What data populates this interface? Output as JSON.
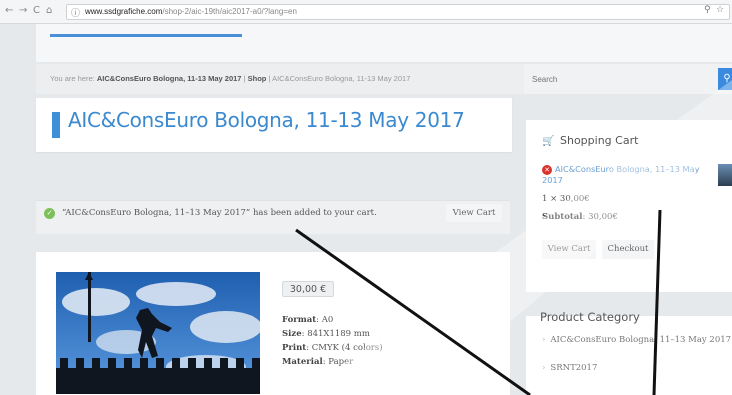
{
  "browser": {
    "nav": {
      "back": "←",
      "forward": "→",
      "reload": "C",
      "home": "⌂"
    },
    "url_host": "www.ssdgrafiche.com",
    "url_path": "/shop-2/aic-19th/aic2017-a0/?lang=en",
    "zoom_icon": "magnifier-icon",
    "star_icon": "star-icon"
  },
  "breadcrumb": {
    "prefix": "You are here:",
    "item1": "AIC&ConsEuro Bologna, 11-13 May 2017",
    "sep1": "|",
    "item2": "Shop",
    "sep2": "|",
    "item3": "AIC&ConsEuro Bologna, 11-13 May 2017"
  },
  "search": {
    "placeholder": "Search"
  },
  "product": {
    "title": "AIC&ConsEuro Bologna, 11-13 May 2017",
    "price": "30,00 €",
    "meta": [
      {
        "label": "Format",
        "value": "A0"
      },
      {
        "label": "Size",
        "value": "841X1189 mm"
      },
      {
        "label": "Print",
        "value": "CMYK (4 colors)"
      },
      {
        "label": "Material",
        "value": "Paper"
      }
    ]
  },
  "notice": {
    "text": "“AIC&ConsEuro Bologna, 11–13 May 2017” has been added to your cart.",
    "button": "View Cart"
  },
  "cart": {
    "title": "Shopping Cart",
    "item_name": "AIC&ConsEuro Bologna, 11–13 May 2017",
    "quantity": "1 × 30,00€",
    "subtotal_label": "Subtotal",
    "subtotal_value": "30,00€",
    "view_cart": "View Cart",
    "checkout": "Checkout"
  },
  "categories": {
    "title": "Product Category",
    "items": [
      "AIC&ConsEuro Bologna, 11–13 May 2017",
      "SRNT2017"
    ]
  },
  "colors": {
    "accent": "#3b89cf",
    "success": "#7cc05a",
    "remove": "#d9342b",
    "link": "#6b9fd2"
  }
}
